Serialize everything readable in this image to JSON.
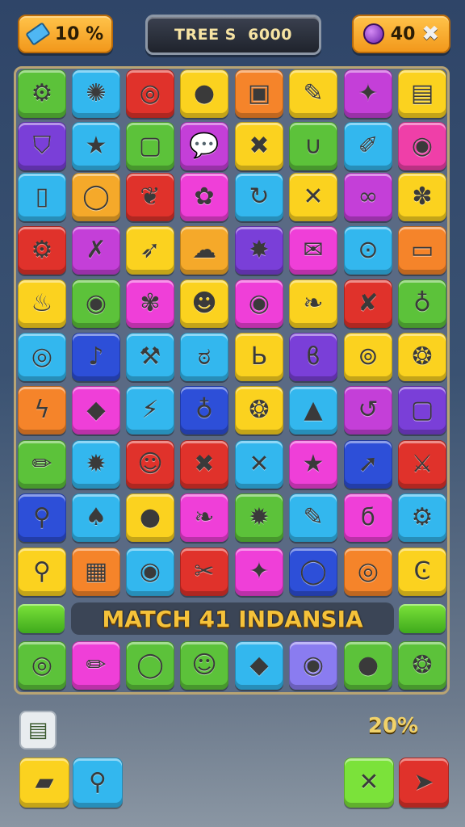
{
  "hud": {
    "left_value": "10 %",
    "left_icon": "eraser-icon",
    "center_title": "TREE S  6000",
    "right_value": "40",
    "right_icon": "potion-icon",
    "right_action_icon": "close-icon"
  },
  "board": {
    "rows": [
      [
        {
          "color": "#5cc23a",
          "icon": "gear-icon",
          "glyph": "⚙"
        },
        {
          "color": "#33b7ee",
          "icon": "sun-gear-icon",
          "glyph": "✺"
        },
        {
          "color": "#e0322b",
          "icon": "swirl-icon",
          "glyph": "◎"
        },
        {
          "color": "#fbd21f",
          "icon": "ball-icon",
          "glyph": "●"
        },
        {
          "color": "#f5842a",
          "icon": "square-icon",
          "glyph": "▣"
        },
        {
          "color": "#fbd21f",
          "icon": "pencil-icon",
          "glyph": "✎"
        },
        {
          "color": "#c43fd8",
          "icon": "pin-icon",
          "glyph": "✦"
        },
        {
          "color": "#fbd21f",
          "icon": "clipboard-icon",
          "glyph": "▤"
        }
      ],
      [
        {
          "color": "#7a3fd8",
          "icon": "shield-icon",
          "glyph": "⛉"
        },
        {
          "color": "#33b7ee",
          "icon": "star-icon",
          "glyph": "★"
        },
        {
          "color": "#5cc23a",
          "icon": "chat-icon",
          "glyph": "▢"
        },
        {
          "color": "#c43fd8",
          "icon": "speech-icon",
          "glyph": "💬"
        },
        {
          "color": "#fbd21f",
          "icon": "leaf-x-icon",
          "glyph": "✖"
        },
        {
          "color": "#5cc23a",
          "icon": "horseshoe-icon",
          "glyph": "∪"
        },
        {
          "color": "#33b7ee",
          "icon": "spoon-icon",
          "glyph": "✐"
        },
        {
          "color": "#ef3fa8",
          "icon": "ring-icon",
          "glyph": "◉"
        }
      ],
      [
        {
          "color": "#33b7ee",
          "icon": "tag-icon",
          "glyph": "▯"
        },
        {
          "color": "#f5a92a",
          "icon": "ring-icon",
          "glyph": "◯"
        },
        {
          "color": "#e0322b",
          "icon": "leaf-icon",
          "glyph": "❦"
        },
        {
          "color": "#ef3fd8",
          "icon": "donut-icon",
          "glyph": "✿"
        },
        {
          "color": "#33b7ee",
          "icon": "refresh-icon",
          "glyph": "↻"
        },
        {
          "color": "#fbd21f",
          "icon": "cross-icon",
          "glyph": "✕"
        },
        {
          "color": "#c43fd8",
          "icon": "link-icon",
          "glyph": "∞"
        },
        {
          "color": "#fbd21f",
          "icon": "flower-icon",
          "glyph": "✽"
        }
      ],
      [
        {
          "color": "#e0322b",
          "icon": "gears-icon",
          "glyph": "⚙"
        },
        {
          "color": "#c43fd8",
          "icon": "x-icon",
          "glyph": "✗"
        },
        {
          "color": "#fbd21f",
          "icon": "feather-icon",
          "glyph": "➶"
        },
        {
          "color": "#f5a92a",
          "icon": "cloud-icon",
          "glyph": "☁"
        },
        {
          "color": "#7a3fd8",
          "icon": "star-burst-icon",
          "glyph": "✸"
        },
        {
          "color": "#ef3fd8",
          "icon": "envelope-icon",
          "glyph": "✉"
        },
        {
          "color": "#33b7ee",
          "icon": "glasses-icon",
          "glyph": "⊙"
        },
        {
          "color": "#f5842a",
          "icon": "window-icon",
          "glyph": "▭"
        }
      ],
      [
        {
          "color": "#fbd21f",
          "icon": "flame-icon",
          "glyph": "♨"
        },
        {
          "color": "#5cc23a",
          "icon": "circle-icon",
          "glyph": "◉"
        },
        {
          "color": "#ef3fd8",
          "icon": "flower-icon",
          "glyph": "✾"
        },
        {
          "color": "#fbd21f",
          "icon": "face-icon",
          "glyph": "☻"
        },
        {
          "color": "#ef3fd8",
          "icon": "target-icon",
          "glyph": "◉"
        },
        {
          "color": "#fbd21f",
          "icon": "pinecone-icon",
          "glyph": "❧"
        },
        {
          "color": "#e0322b",
          "icon": "x-leaf-icon",
          "glyph": "✘"
        },
        {
          "color": "#5cc23a",
          "icon": "drop-icon",
          "glyph": "♁"
        }
      ],
      [
        {
          "color": "#33b7ee",
          "icon": "donut-icon",
          "glyph": "◎"
        },
        {
          "color": "#2d4fd8",
          "icon": "bulb-icon",
          "glyph": "♪"
        },
        {
          "color": "#33b7ee",
          "icon": "wrench-icon",
          "glyph": "⚒"
        },
        {
          "color": "#33b7ee",
          "icon": "swirl-icon",
          "glyph": "ಠ"
        },
        {
          "color": "#fbd21f",
          "icon": "letter-b-icon",
          "glyph": "Ь"
        },
        {
          "color": "#7a3fd8",
          "icon": "knot-icon",
          "glyph": "ϐ"
        },
        {
          "color": "#fbd21f",
          "icon": "search-icon",
          "glyph": "⊚"
        },
        {
          "color": "#fbd21f",
          "icon": "leaf-pin-icon",
          "glyph": "❂"
        }
      ],
      [
        {
          "color": "#f5842a",
          "icon": "lightning-icon",
          "glyph": "ϟ"
        },
        {
          "color": "#ef3fd8",
          "icon": "gem-icon",
          "glyph": "◆"
        },
        {
          "color": "#33b7ee",
          "icon": "bolt-icon",
          "glyph": "⚡"
        },
        {
          "color": "#2d4fd8",
          "icon": "ring-icon",
          "glyph": "♁"
        },
        {
          "color": "#fbd21f",
          "icon": "leaf-icon",
          "glyph": "❂"
        },
        {
          "color": "#33b7ee",
          "icon": "tower-icon",
          "glyph": "▲"
        },
        {
          "color": "#c43fd8",
          "icon": "refresh-icon",
          "glyph": "↺"
        },
        {
          "color": "#7a3fd8",
          "icon": "square-icon",
          "glyph": "▢"
        }
      ],
      [
        {
          "color": "#5cc23a",
          "icon": "lipstick-icon",
          "glyph": "✏"
        },
        {
          "color": "#33b7ee",
          "icon": "splat-icon",
          "glyph": "✹"
        },
        {
          "color": "#e0322b",
          "icon": "ghost-icon",
          "glyph": "☺"
        },
        {
          "color": "#e0322b",
          "icon": "x-icon",
          "glyph": "✖"
        },
        {
          "color": "#33b7ee",
          "icon": "tools-icon",
          "glyph": "✕"
        },
        {
          "color": "#ef3fd8",
          "icon": "star-icon",
          "glyph": "★"
        },
        {
          "color": "#2d4fd8",
          "icon": "arrow-icon",
          "glyph": "➚"
        },
        {
          "color": "#e0322b",
          "icon": "sword-icon",
          "glyph": "⚔"
        }
      ],
      [
        {
          "color": "#2d4fd8",
          "icon": "search-icon",
          "glyph": "⚲"
        },
        {
          "color": "#33b7ee",
          "icon": "bell-icon",
          "glyph": "♠"
        },
        {
          "color": "#fbd21f",
          "icon": "balloon-icon",
          "glyph": "●"
        },
        {
          "color": "#ef3fd8",
          "icon": "leaf-icon",
          "glyph": "❧"
        },
        {
          "color": "#5cc23a",
          "icon": "gear-icon",
          "glyph": "✹"
        },
        {
          "color": "#33b7ee",
          "icon": "pen-icon",
          "glyph": "✎"
        },
        {
          "color": "#ef3fd8",
          "icon": "swirl-icon",
          "glyph": "ϭ"
        },
        {
          "color": "#33b7ee",
          "icon": "cog-icon",
          "glyph": "⚙"
        }
      ],
      [
        {
          "color": "#fbd21f",
          "icon": "search-icon",
          "glyph": "⚲"
        },
        {
          "color": "#f5842a",
          "icon": "film-icon",
          "glyph": "▦"
        },
        {
          "color": "#33b7ee",
          "icon": "pin-icon",
          "glyph": "◉"
        },
        {
          "color": "#e0322b",
          "icon": "scissors-icon",
          "glyph": "✂"
        },
        {
          "color": "#ef3fd8",
          "icon": "spark-icon",
          "glyph": "✦"
        },
        {
          "color": "#2d4fd8",
          "icon": "ring-icon",
          "glyph": "◯"
        },
        {
          "color": "#f5842a",
          "icon": "coil-icon",
          "glyph": "◎"
        },
        {
          "color": "#fbd21f",
          "icon": "letter-c-icon",
          "glyph": "Ͼ"
        }
      ],
      [],
      [
        {
          "color": "#5cc23a",
          "icon": "donut-icon",
          "glyph": "◎"
        },
        {
          "color": "#ef3fd8",
          "icon": "pencil-icon",
          "glyph": "✏"
        },
        {
          "color": "#5cc23a",
          "icon": "chat-icon",
          "glyph": "◯"
        },
        {
          "color": "#5cc23a",
          "icon": "cat-icon",
          "glyph": "☺"
        },
        {
          "color": "#33b7ee",
          "icon": "candy-icon",
          "glyph": "◆"
        },
        {
          "color": "#8a7cf0",
          "icon": "ring-icon",
          "glyph": "◉"
        },
        {
          "color": "#5cc23a",
          "icon": "balloon-icon",
          "glyph": "●"
        },
        {
          "color": "#5cc23a",
          "icon": "leaf-icon",
          "glyph": "❂"
        }
      ]
    ],
    "banner_text": "MATCH 41 INDANSIA"
  },
  "footer": {
    "clipboard_icon": "clipboard-icon",
    "percent_text": "20%",
    "buttons": [
      {
        "name": "eraser-button",
        "color": "#fbd21f",
        "icon": "eraser-icon",
        "glyph": "▰"
      },
      {
        "name": "search-button",
        "color": "#33b7ee",
        "icon": "search-icon",
        "glyph": "⚲"
      },
      {
        "name": "tools-button",
        "color": "#7be23a",
        "icon": "tools-icon",
        "glyph": "✕"
      },
      {
        "name": "leaf-button",
        "color": "#e0322b",
        "icon": "leaf-icon",
        "glyph": "➤"
      }
    ]
  }
}
